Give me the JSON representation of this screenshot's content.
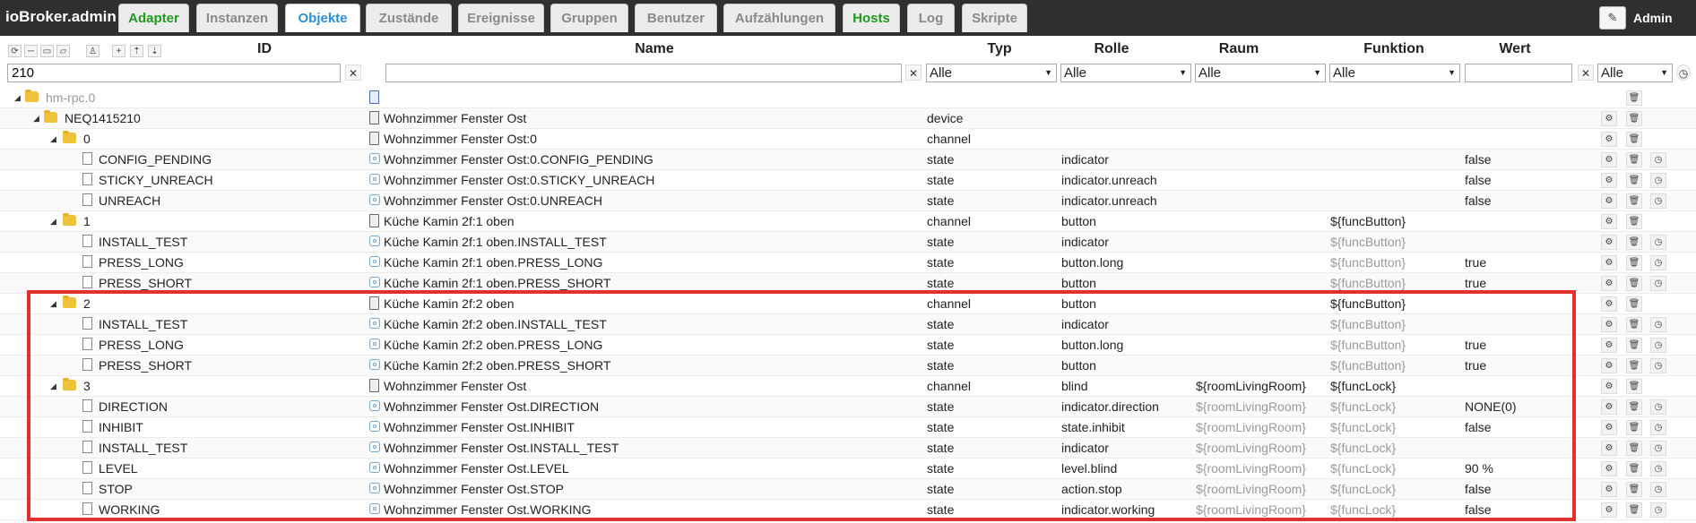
{
  "app": {
    "title": "ioBroker.admin",
    "user": "Admin"
  },
  "tabs": [
    {
      "label": "Adapter",
      "color": "green"
    },
    {
      "label": "Instanzen"
    },
    {
      "label": "Objekte",
      "active": true
    },
    {
      "label": "Zustände"
    },
    {
      "label": "Ereignisse"
    },
    {
      "label": "Gruppen"
    },
    {
      "label": "Benutzer"
    },
    {
      "label": "Aufzählungen"
    },
    {
      "label": "Hosts",
      "color": "green"
    },
    {
      "label": "Log"
    },
    {
      "label": "Skripte"
    }
  ],
  "columns": {
    "id": "ID",
    "name": "Name",
    "type": "Typ",
    "role": "Rolle",
    "room": "Raum",
    "function": "Funktion",
    "value": "Wert"
  },
  "filters": {
    "id": "210",
    "name": "",
    "type": "Alle",
    "role": "Alle",
    "room": "Alle",
    "function": "Alle",
    "value": "",
    "last": "Alle"
  },
  "rows": [
    {
      "level": 0,
      "kind": "folder",
      "expanded": true,
      "id": "hm-rpc.0",
      "name": "",
      "type": "",
      "role": "",
      "room": "",
      "func": "",
      "value": "",
      "idGrey": true
    },
    {
      "level": 1,
      "kind": "folder",
      "expanded": true,
      "id": "NEQ1415210",
      "name": "Wohnzimmer Fenster Ost",
      "type": "device",
      "role": "",
      "room": "",
      "func": "",
      "value": ""
    },
    {
      "level": 2,
      "kind": "folder",
      "expanded": true,
      "id": "0",
      "name": "Wohnzimmer Fenster Ost:0",
      "type": "channel",
      "role": "",
      "room": "",
      "func": "",
      "value": ""
    },
    {
      "level": 3,
      "kind": "state",
      "id": "CONFIG_PENDING",
      "name": "Wohnzimmer Fenster Ost:0.CONFIG_PENDING",
      "type": "state",
      "role": "indicator",
      "room": "",
      "func": "",
      "value": "false"
    },
    {
      "level": 3,
      "kind": "state",
      "id": "STICKY_UNREACH",
      "name": "Wohnzimmer Fenster Ost:0.STICKY_UNREACH",
      "type": "state",
      "role": "indicator.unreach",
      "room": "",
      "func": "",
      "value": "false"
    },
    {
      "level": 3,
      "kind": "state",
      "id": "UNREACH",
      "name": "Wohnzimmer Fenster Ost:0.UNREACH",
      "type": "state",
      "role": "indicator.unreach",
      "room": "",
      "func": "",
      "value": "false"
    },
    {
      "level": 2,
      "kind": "folder",
      "expanded": true,
      "id": "1",
      "name": "Küche Kamin 2f:1 oben",
      "type": "channel",
      "role": "button",
      "room": "",
      "func": "${funcButton}",
      "value": ""
    },
    {
      "level": 3,
      "kind": "state",
      "id": "INSTALL_TEST",
      "name": "Küche Kamin 2f:1 oben.INSTALL_TEST",
      "type": "state",
      "role": "indicator",
      "room": "",
      "func": "${funcButton}",
      "funcGrey": true,
      "value": ""
    },
    {
      "level": 3,
      "kind": "state",
      "id": "PRESS_LONG",
      "name": "Küche Kamin 2f:1 oben.PRESS_LONG",
      "type": "state",
      "role": "button.long",
      "room": "",
      "func": "${funcButton}",
      "funcGrey": true,
      "value": "true"
    },
    {
      "level": 3,
      "kind": "state",
      "id": "PRESS_SHORT",
      "name": "Küche Kamin 2f:1 oben.PRESS_SHORT",
      "type": "state",
      "role": "button",
      "room": "",
      "func": "${funcButton}",
      "funcGrey": true,
      "value": "true"
    },
    {
      "level": 2,
      "kind": "folder",
      "expanded": true,
      "id": "2",
      "name": "Küche Kamin 2f:2 oben",
      "type": "channel",
      "role": "button",
      "room": "",
      "func": "${funcButton}",
      "value": ""
    },
    {
      "level": 3,
      "kind": "state",
      "id": "INSTALL_TEST",
      "name": "Küche Kamin 2f:2 oben.INSTALL_TEST",
      "type": "state",
      "role": "indicator",
      "room": "",
      "func": "${funcButton}",
      "funcGrey": true,
      "value": ""
    },
    {
      "level": 3,
      "kind": "state",
      "id": "PRESS_LONG",
      "name": "Küche Kamin 2f:2 oben.PRESS_LONG",
      "type": "state",
      "role": "button.long",
      "room": "",
      "func": "${funcButton}",
      "funcGrey": true,
      "value": "true"
    },
    {
      "level": 3,
      "kind": "state",
      "id": "PRESS_SHORT",
      "name": "Küche Kamin 2f:2 oben.PRESS_SHORT",
      "type": "state",
      "role": "button",
      "room": "",
      "func": "${funcButton}",
      "funcGrey": true,
      "value": "true"
    },
    {
      "level": 2,
      "kind": "folder",
      "expanded": true,
      "id": "3",
      "name": "Wohnzimmer Fenster Ost",
      "type": "channel",
      "role": "blind",
      "room": "${roomLivingRoom}",
      "func": "${funcLock}",
      "value": ""
    },
    {
      "level": 3,
      "kind": "state",
      "id": "DIRECTION",
      "name": "Wohnzimmer Fenster Ost.DIRECTION",
      "type": "state",
      "role": "indicator.direction",
      "room": "${roomLivingRoom}",
      "roomGrey": true,
      "func": "${funcLock}",
      "funcGrey": true,
      "value": "NONE(0)"
    },
    {
      "level": 3,
      "kind": "state",
      "id": "INHIBIT",
      "name": "Wohnzimmer Fenster Ost.INHIBIT",
      "type": "state",
      "role": "state.inhibit",
      "room": "${roomLivingRoom}",
      "roomGrey": true,
      "func": "${funcLock}",
      "funcGrey": true,
      "value": "false"
    },
    {
      "level": 3,
      "kind": "state",
      "id": "INSTALL_TEST",
      "name": "Wohnzimmer Fenster Ost.INSTALL_TEST",
      "type": "state",
      "role": "indicator",
      "room": "${roomLivingRoom}",
      "roomGrey": true,
      "func": "${funcLock}",
      "funcGrey": true,
      "value": ""
    },
    {
      "level": 3,
      "kind": "state",
      "id": "LEVEL",
      "name": "Wohnzimmer Fenster Ost.LEVEL",
      "type": "state",
      "role": "level.blind",
      "room": "${roomLivingRoom}",
      "roomGrey": true,
      "func": "${funcLock}",
      "funcGrey": true,
      "value": "90 %"
    },
    {
      "level": 3,
      "kind": "state",
      "id": "STOP",
      "name": "Wohnzimmer Fenster Ost.STOP",
      "type": "state",
      "role": "action.stop",
      "room": "${roomLivingRoom}",
      "roomGrey": true,
      "func": "${funcLock}",
      "funcGrey": true,
      "value": "false"
    },
    {
      "level": 3,
      "kind": "state",
      "id": "WORKING",
      "name": "Wohnzimmer Fenster Ost.WORKING",
      "type": "state",
      "role": "indicator.working",
      "room": "${roomLivingRoom}",
      "roomGrey": true,
      "func": "${funcLock}",
      "funcGrey": true,
      "value": "false"
    }
  ],
  "colors": {
    "highlight": "#e03030",
    "tab_active": "#2b8fd6",
    "tab_green": "#1f9a1f",
    "topbar": "#2f2f2f"
  }
}
